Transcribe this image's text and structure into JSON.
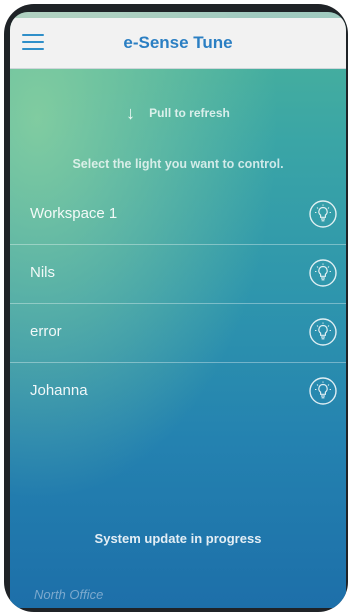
{
  "app": {
    "title": "e-Sense Tune"
  },
  "refresh": {
    "label": "Pull to refresh",
    "icon": "down-arrow-icon"
  },
  "instruction": "Select the light you want to control.",
  "lights": [
    {
      "name": "Workspace 1",
      "icon": "lightbulb-icon"
    },
    {
      "name": "Nils",
      "icon": "lightbulb-icon"
    },
    {
      "name": "error",
      "icon": "lightbulb-icon"
    },
    {
      "name": "Johanna",
      "icon": "lightbulb-icon"
    }
  ],
  "status": {
    "message": "System update in progress"
  },
  "location": {
    "name": "North Office"
  },
  "colors": {
    "accent": "#2b7fc3",
    "navbar_bg": "#f2f2f2",
    "gradient_top": "#4bb39a",
    "gradient_bottom": "#1d6fa9"
  }
}
